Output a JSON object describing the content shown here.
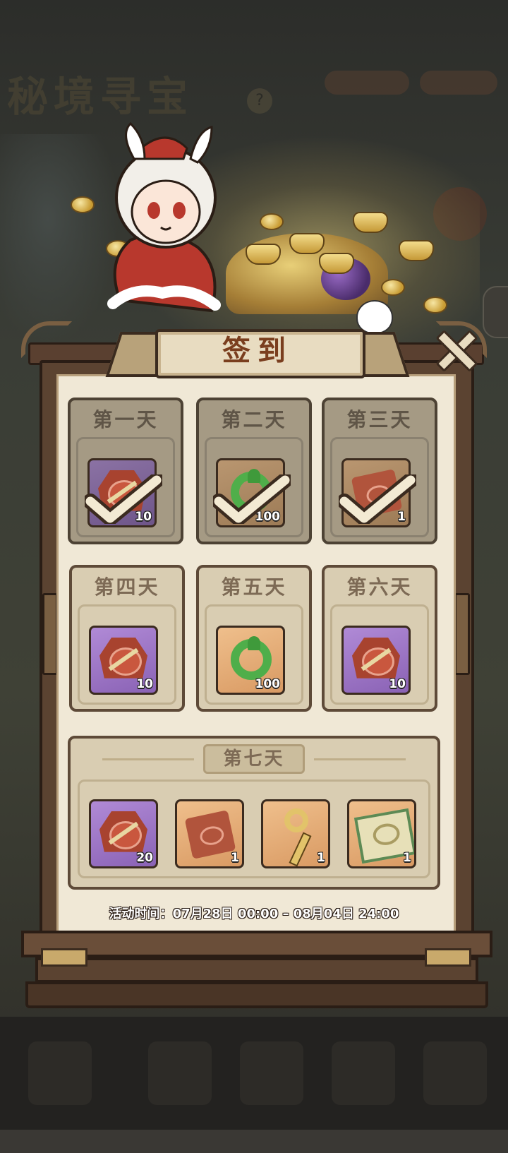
{
  "background": {
    "title": "秘境寻宝",
    "help_icon": "question-icon"
  },
  "dialog": {
    "title": "签到",
    "close_icon": "close-icon"
  },
  "days": [
    {
      "label": "第一天",
      "claimed": true,
      "item": {
        "icon": "token-icon",
        "rarity": "purple",
        "qty": "10"
      }
    },
    {
      "label": "第二天",
      "claimed": true,
      "item": {
        "icon": "jade-icon",
        "rarity": "orange",
        "qty": "100"
      }
    },
    {
      "label": "第三天",
      "claimed": true,
      "item": {
        "icon": "scroll-icon",
        "rarity": "orange",
        "qty": "1"
      }
    },
    {
      "label": "第四天",
      "claimed": false,
      "item": {
        "icon": "token-icon",
        "rarity": "purple",
        "qty": "10"
      }
    },
    {
      "label": "第五天",
      "claimed": false,
      "item": {
        "icon": "jade-icon",
        "rarity": "orange",
        "qty": "100"
      }
    },
    {
      "label": "第六天",
      "claimed": false,
      "item": {
        "icon": "token-icon",
        "rarity": "purple",
        "qty": "10"
      }
    }
  ],
  "day7": {
    "label": "第七天",
    "items": [
      {
        "icon": "token-icon",
        "rarity": "purple",
        "qty": "20"
      },
      {
        "icon": "scroll-icon",
        "rarity": "orange",
        "qty": "1"
      },
      {
        "icon": "key-icon",
        "rarity": "orange",
        "qty": "1"
      },
      {
        "icon": "book-icon",
        "rarity": "orange",
        "qty": "1"
      }
    ]
  },
  "period": {
    "label": "活动时间：",
    "value": "07月28日 00:00 – 08月04日 24:00"
  },
  "colors": {
    "purple_slot": "#9a72c4",
    "orange_slot": "#e4ab74",
    "title_text": "#7a3e1e",
    "frame_wood": "#5b4331"
  }
}
